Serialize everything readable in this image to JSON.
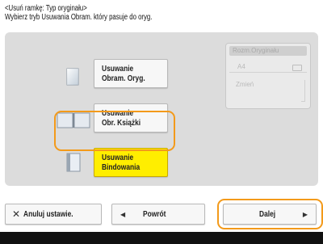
{
  "header": {
    "title": "<Usuń ramkę: Typ oryginału>",
    "instruction": "Wybierz tryb Usuwania Obram. który pasuje do oryg."
  },
  "options": [
    {
      "line1": "Usuwanie",
      "line2": "Obram. Oryg.",
      "icon": "document-icon",
      "selected": false
    },
    {
      "line1": "Usuwanie",
      "line2": "Obr. Książki",
      "icon": "open-book-icon",
      "selected": false
    },
    {
      "line1": "Usuwanie",
      "line2": "Bindowania",
      "icon": "bound-document-icon",
      "selected": true
    }
  ],
  "side_panel": {
    "title": "Rozm.Oryginału",
    "value": "A4",
    "change_label": "Zmień"
  },
  "footer": {
    "cancel_label": "Anuluj ustawie.",
    "back_label": "Powrót",
    "next_label": "Dalej"
  },
  "colors": {
    "selected_fill": "#ffee00",
    "highlight_ring": "#f39a1a",
    "panel_bg": "#dcdcdc"
  }
}
